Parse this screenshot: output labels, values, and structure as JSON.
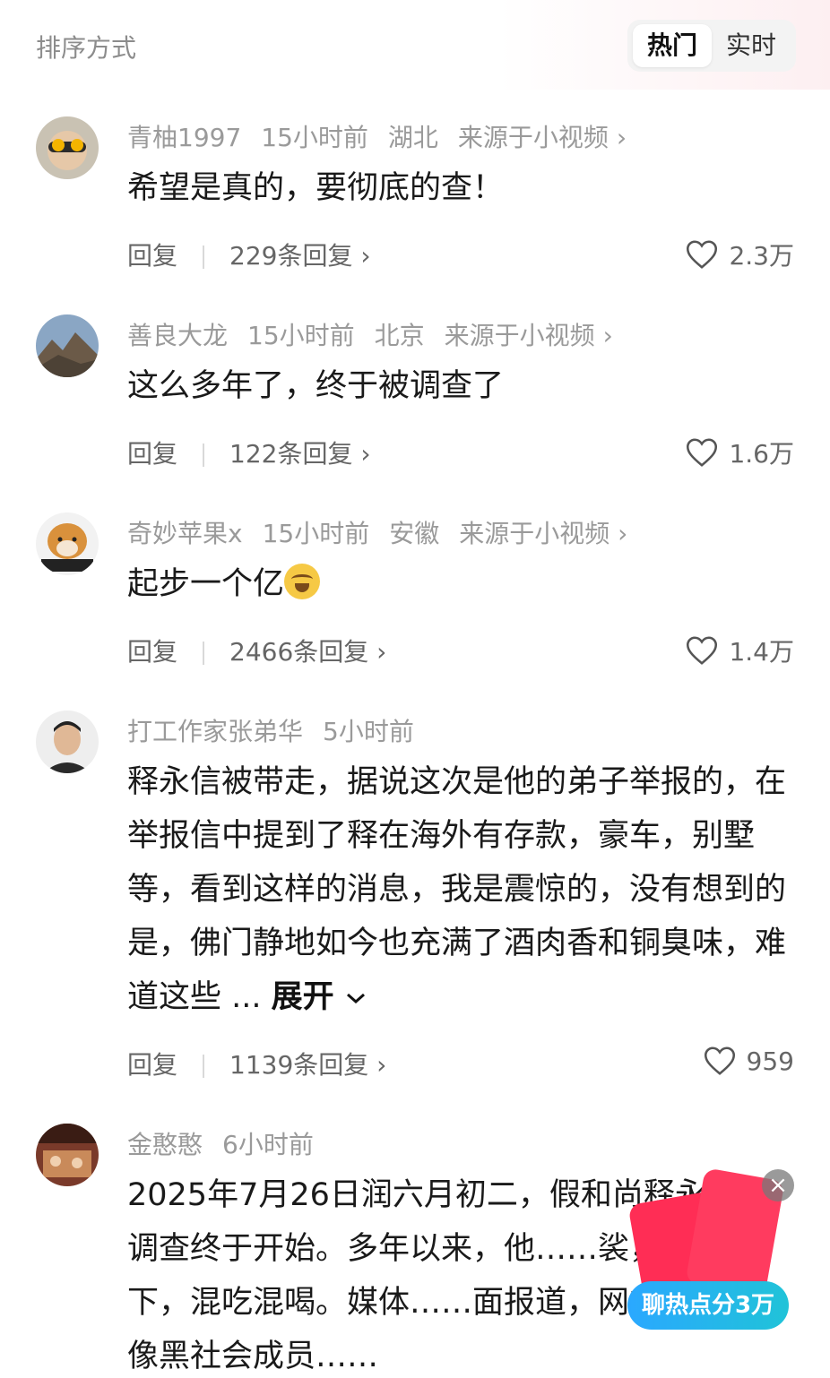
{
  "header": {
    "sort_label": "排序方式",
    "tab_hot": "热门",
    "tab_realtime": "实时"
  },
  "comments": [
    {
      "user": "青柚1997",
      "time": "15小时前",
      "location": "湖北",
      "source": "来源于小视频",
      "text": "希望是真的，要彻底的查！",
      "reply_label": "回复",
      "replies": "229条回复",
      "likes": "2.3万"
    },
    {
      "user": "善良大龙",
      "time": "15小时前",
      "location": "北京",
      "source": "来源于小视频",
      "text": "这么多年了，终于被调查了",
      "reply_label": "回复",
      "replies": "122条回复",
      "likes": "1.6万"
    },
    {
      "user": "奇妙苹果x",
      "time": "15小时前",
      "location": "安徽",
      "source": "来源于小视频",
      "text": "起步一个亿",
      "reply_label": "回复",
      "replies": "2466条回复",
      "likes": "1.4万"
    },
    {
      "user": "打工作家张弟华",
      "time": "5小时前",
      "text": "释永信被带走，据说这次是他的弟子举报的，在举报信中提到了释在海外有存款，豪车，别墅等，看到这样的消息，我是震惊的，没有想到的是，佛门静地如今也充满了酒肉香和铜臭味，难道这些 ...",
      "expand": "展开",
      "reply_label": "回复",
      "replies": "1139条回复",
      "likes": "959"
    },
    {
      "user": "金憨憨",
      "time": "6小时前",
      "text": "2025年7月26日润六月初二，假和尚释永信的调查终于开始。多年以来，他……裟，欺上瞒下，混吃混喝。媒体……面报道，网友评论称他像黑社会成员……"
    }
  ],
  "floating": {
    "close": "×",
    "pill_text": "聊热点分3万"
  },
  "colors": {
    "meta_gray": "#9a9a9a",
    "pill_blue": "#2aa8ff",
    "red_packet": "#ff2d55"
  }
}
